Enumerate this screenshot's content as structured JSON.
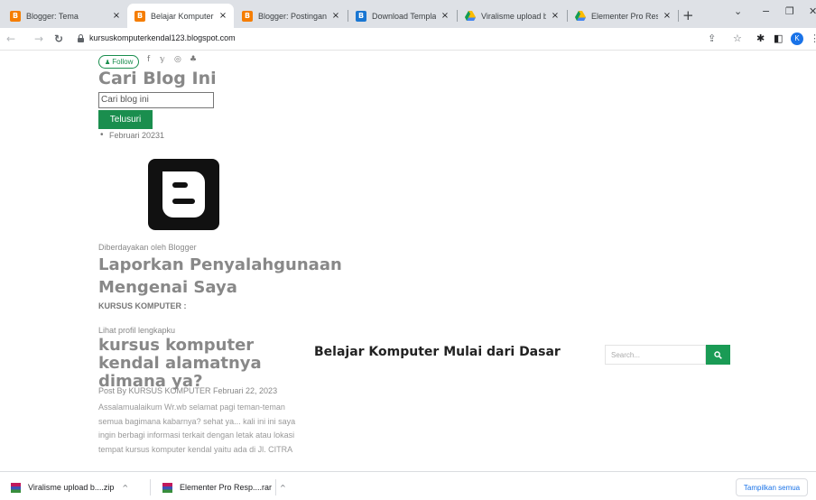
{
  "browser": {
    "tabs": [
      {
        "title": "Blogger: Tema",
        "favicon": "blogger-icon",
        "active": false
      },
      {
        "title": "Belajar Komputer Mulai",
        "favicon": "blogger-icon",
        "active": true
      },
      {
        "title": "Blogger: Postingan",
        "favicon": "blogger-icon",
        "active": false
      },
      {
        "title": "Download Template Blo",
        "favicon": "blogger-template-icon",
        "active": false
      },
      {
        "title": "Viralisme upload by ver",
        "favicon": "google-drive-icon",
        "active": false
      },
      {
        "title": "Elementer Pro Respons",
        "favicon": "google-drive-icon",
        "active": false
      }
    ],
    "close_glyph": "×",
    "new_tab_glyph": "+",
    "window_controls": {
      "chevron": "⌄",
      "minimize": "−",
      "restore": "❐",
      "close": "✕"
    },
    "nav": {
      "back": "←",
      "forward": "→",
      "reload": "↻"
    },
    "url": "kursuskomputerkendal123.blogspot.com",
    "toolbar_icons": {
      "share": "⇪",
      "star": "☆",
      "extensions": "✱",
      "sidebar": "◧",
      "menu": "⋮"
    },
    "profile_letter": "K",
    "accent": "#1a73e8"
  },
  "page": {
    "follow_label": "Follow",
    "social_icons": [
      "f",
      "𝕪",
      "◎",
      "♣"
    ],
    "search_title": "Cari Blog Ini",
    "search_input_value": "Cari blog ini",
    "search_button": "Telusuri",
    "archive_item": "Februari 20231",
    "powered_by": "Diberdayakan oleh Blogger",
    "report_heading": "Laporkan Penyalahgunaan",
    "about_heading": "Mengenai Saya",
    "author_name": "KURSUS KOMPUTER :",
    "profile_link": "Lihat profil lengkapku",
    "post_title": "kursus komputer kendal alamatnya dimana ya?",
    "post_meta": "Post By KURSUS KOMPUTER Februari 22, 2023",
    "post_excerpt": " Assalamualaikum Wr.wb selamat pagi teman-teman semua bagimana kabarnya? sehat ya... kali ini ini saya ingin berbagi informasi terkait dengan letak atau lokasi tempat kursus komputer kendal yaitu ada di Jl. CITRA",
    "center_title": "Belajar Komputer Mulai dari Dasar",
    "search_placeholder": "Search...",
    "brand_green": "#1a8e4e"
  },
  "downloads": {
    "items": [
      {
        "name": "Viralisme upload b....zip",
        "icon": "winrar-archive-icon"
      },
      {
        "name": "Elementer Pro Resp....rar",
        "icon": "winrar-archive-icon"
      }
    ],
    "chevron": "^",
    "show_all": "Tampilkan semua"
  }
}
